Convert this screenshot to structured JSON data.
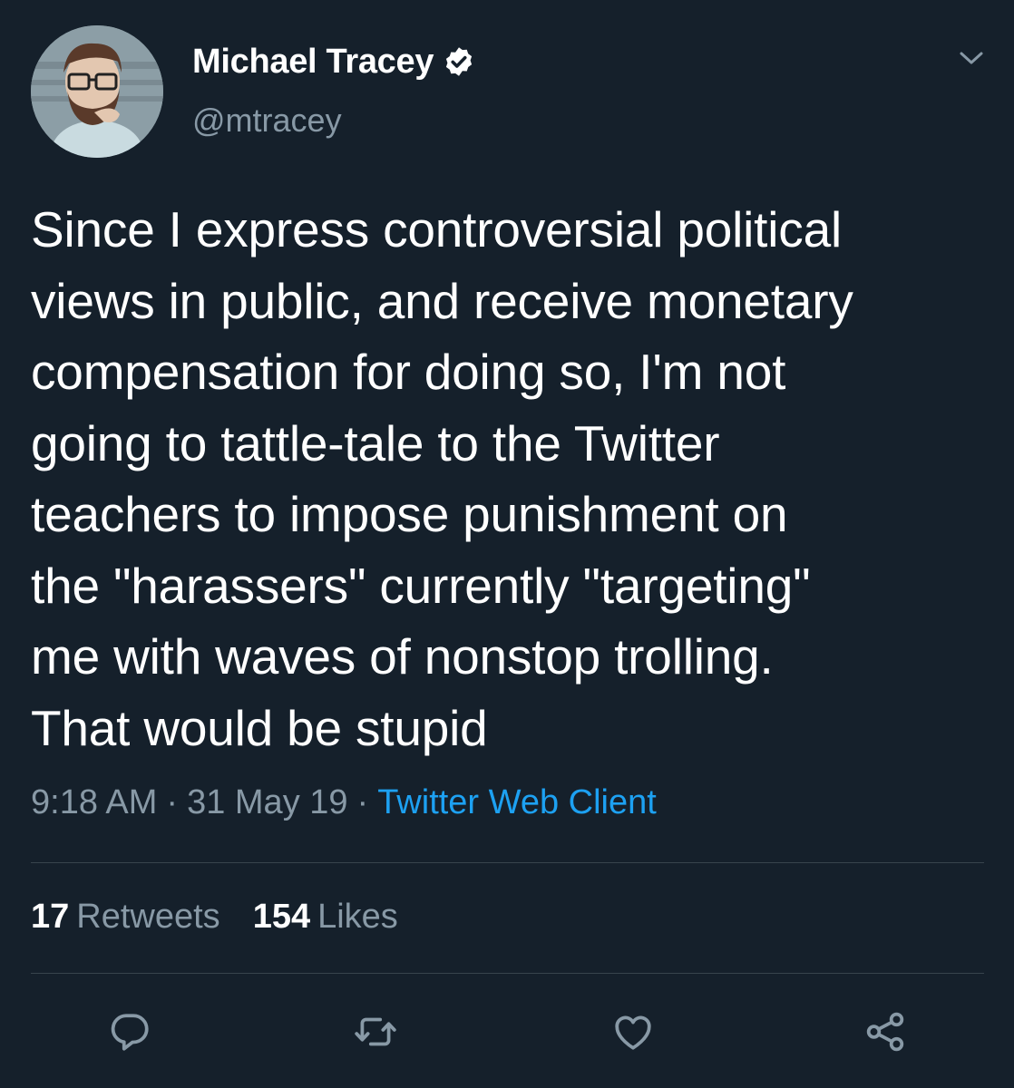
{
  "author": {
    "display_name": "Michael Tracey",
    "handle": "@mtracey",
    "verified": true
  },
  "tweet": {
    "text": "Since I express controversial political\nviews in public, and receive monetary\ncompensation for doing so, I'm not\ngoing to tattle-tale to the Twitter\nteachers to impose punishment on\nthe \"harassers\" currently \"targeting\"\nme with waves of nonstop trolling.\nThat would be stupid",
    "time": "9:18 AM",
    "separator": "·",
    "date": "31 May 19",
    "client": "Twitter Web Client"
  },
  "stats": {
    "retweets_count": "17",
    "retweets_label": "Retweets",
    "likes_count": "154",
    "likes_label": "Likes"
  },
  "actions": [
    {
      "icon": "reply-icon"
    },
    {
      "icon": "retweet-icon"
    },
    {
      "icon": "like-icon"
    },
    {
      "icon": "share-icon"
    }
  ],
  "colors": {
    "background": "#15202b",
    "text": "#ffffff",
    "secondary_text": "#8899a6",
    "link": "#1da1f2",
    "divider": "#38444d"
  }
}
